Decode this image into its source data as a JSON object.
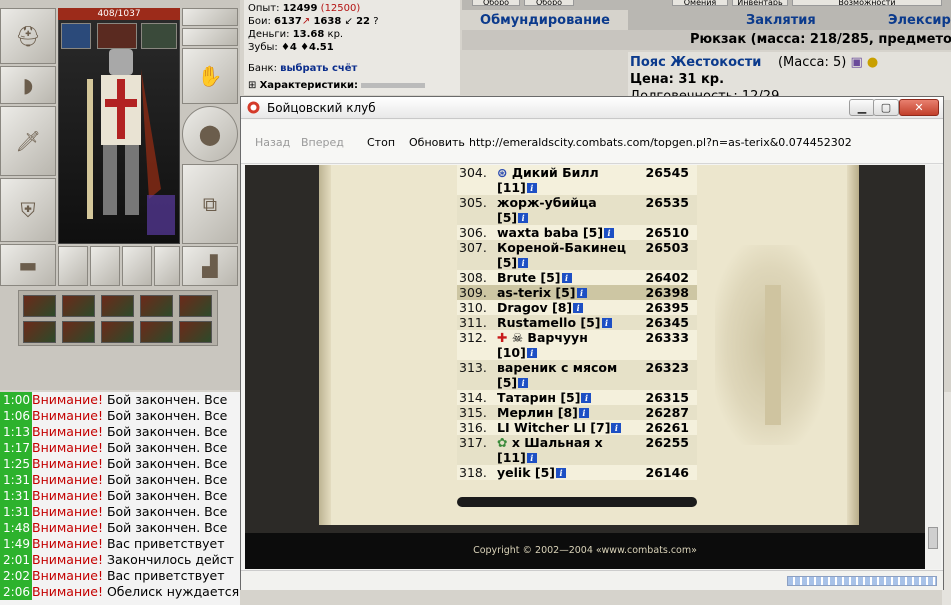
{
  "character": {
    "hp": "408/1037"
  },
  "stats": {
    "exp_label": "Опыт:",
    "exp_value": "12499",
    "exp_next": "(12500)",
    "battles_label": "Бои:",
    "battles_value": "6137",
    "battles_value2": "1638",
    "battles_value3": "22",
    "money_label": "Деньги:",
    "money_value": "13.68",
    "money_unit": "кр.",
    "teeth_label": "Зубы:",
    "teeth_value": "4",
    "teeth_value2": "4.51",
    "bank_label": "Банк:",
    "bank_link": "выбрать счёт",
    "characteristics": "Характеристики:"
  },
  "shop": {
    "top_tabs": [
      "Оборо",
      "Оборо",
      "Омения",
      "Инвентарь",
      "Возможности"
    ],
    "categories": [
      "Обмундирование",
      "Заклятия",
      "Элексир"
    ],
    "backpack": "Рюкзак (масса: 218/285, предмето",
    "item_name": "Пояс Жестокости",
    "item_mass": "(Масса: 5)",
    "item_price": "Цена: 31 кр.",
    "item_durability": "Долговечность: 12/29"
  },
  "chat": [
    {
      "time": "1:00",
      "warn": "Внимание!",
      "text": " Бой закончен. Все"
    },
    {
      "time": "1:06",
      "warn": "Внимание!",
      "text": " Бой закончен. Все"
    },
    {
      "time": "1:13",
      "warn": "Внимание!",
      "text": " Бой закончен. Все"
    },
    {
      "time": "1:17",
      "warn": "Внимание!",
      "text": " Бой закончен. Все"
    },
    {
      "time": "1:25",
      "warn": "Внимание!",
      "text": " Бой закончен. Все"
    },
    {
      "time": "1:31",
      "warn": "Внимание!",
      "text": " Бой закончен. Все"
    },
    {
      "time": "1:31",
      "warn": "Внимание!",
      "text": " Бой закончен. Все"
    },
    {
      "time": "1:31",
      "warn": "Внимание!",
      "text": " Бой закончен. Все"
    },
    {
      "time": "1:48",
      "warn": "Внимание!",
      "text": " Бой закончен. Все"
    },
    {
      "time": "1:49",
      "warn": "Внимание!",
      "text": " Вас приветствует"
    },
    {
      "time": "2:01",
      "warn": "Внимание!",
      "text": " Закончилось дейст"
    },
    {
      "time": "2:02",
      "warn": "Внимание!",
      "text": " Вас приветствует"
    },
    {
      "time": "2:06",
      "warn": "Внимание!",
      "text": " Обелиск нуждается в еде..."
    }
  ],
  "window": {
    "title": "Бойцовский клуб",
    "back": "Назад",
    "forward": "Вперед",
    "stop": "Стоп",
    "refresh": "Обновить",
    "url": "http://emeraldscity.combats.com/topgen.pl?n=as-terix&0.074452302",
    "copyright": "Copyright © 2002—2004 «www.combats.com»"
  },
  "ranking": [
    {
      "num": "304.",
      "name": "Дикий Билл",
      "level": "",
      "score": "26545",
      "icon": "clan"
    },
    {
      "num": "",
      "name": "[11]",
      "level": "",
      "score": "",
      "icon": ""
    },
    {
      "num": "305.",
      "name": "жорж-убийца",
      "level": "",
      "score": "26535",
      "icon": ""
    },
    {
      "num": "",
      "name": "[5]",
      "level": "",
      "score": "",
      "icon": ""
    },
    {
      "num": "306.",
      "name": "waxta baba [5]",
      "level": "",
      "score": "26510",
      "icon": ""
    },
    {
      "num": "307.",
      "name": "Кореной-Бакинец",
      "level": "",
      "score": "26503",
      "icon": ""
    },
    {
      "num": "",
      "name": "[5]",
      "level": "",
      "score": "",
      "icon": ""
    },
    {
      "num": "308.",
      "name": "Brute [5]",
      "level": "",
      "score": "26402",
      "icon": ""
    },
    {
      "num": "309.",
      "name": "as-terix [5]",
      "level": "",
      "score": "26398",
      "icon": ""
    },
    {
      "num": "310.",
      "name": "Dragov [8]",
      "level": "",
      "score": "26395",
      "icon": ""
    },
    {
      "num": "311.",
      "name": "Rustamello [5]",
      "level": "",
      "score": "26345",
      "icon": ""
    },
    {
      "num": "312.",
      "name": "Варчуун",
      "level": "",
      "score": "26333",
      "icon": "clan2"
    },
    {
      "num": "",
      "name": "[10]",
      "level": "",
      "score": "",
      "icon": ""
    },
    {
      "num": "313.",
      "name": "вареник с мясом",
      "level": "",
      "score": "26323",
      "icon": ""
    },
    {
      "num": "",
      "name": "[5]",
      "level": "",
      "score": "",
      "icon": ""
    },
    {
      "num": "314.",
      "name": "Татарин [5]",
      "level": "",
      "score": "26315",
      "icon": ""
    },
    {
      "num": "315.",
      "name": "Мерлин [8]",
      "level": "",
      "score": "26287",
      "icon": ""
    },
    {
      "num": "316.",
      "name": "LI Witcher LI [7]",
      "level": "",
      "score": "26261",
      "icon": ""
    },
    {
      "num": "317.",
      "name": "х Шальная х",
      "level": "",
      "score": "26255",
      "icon": "flower"
    },
    {
      "num": "",
      "name": "[11]",
      "level": "",
      "score": "",
      "icon": ""
    },
    {
      "num": "318.",
      "name": "yelik [5]",
      "level": "",
      "score": "26146",
      "icon": ""
    }
  ],
  "colors": {
    "accent_blue": "#0b3a8c",
    "warn_red": "#c40000",
    "time_green": "#2db22d",
    "parchment": "#ece6cd"
  }
}
